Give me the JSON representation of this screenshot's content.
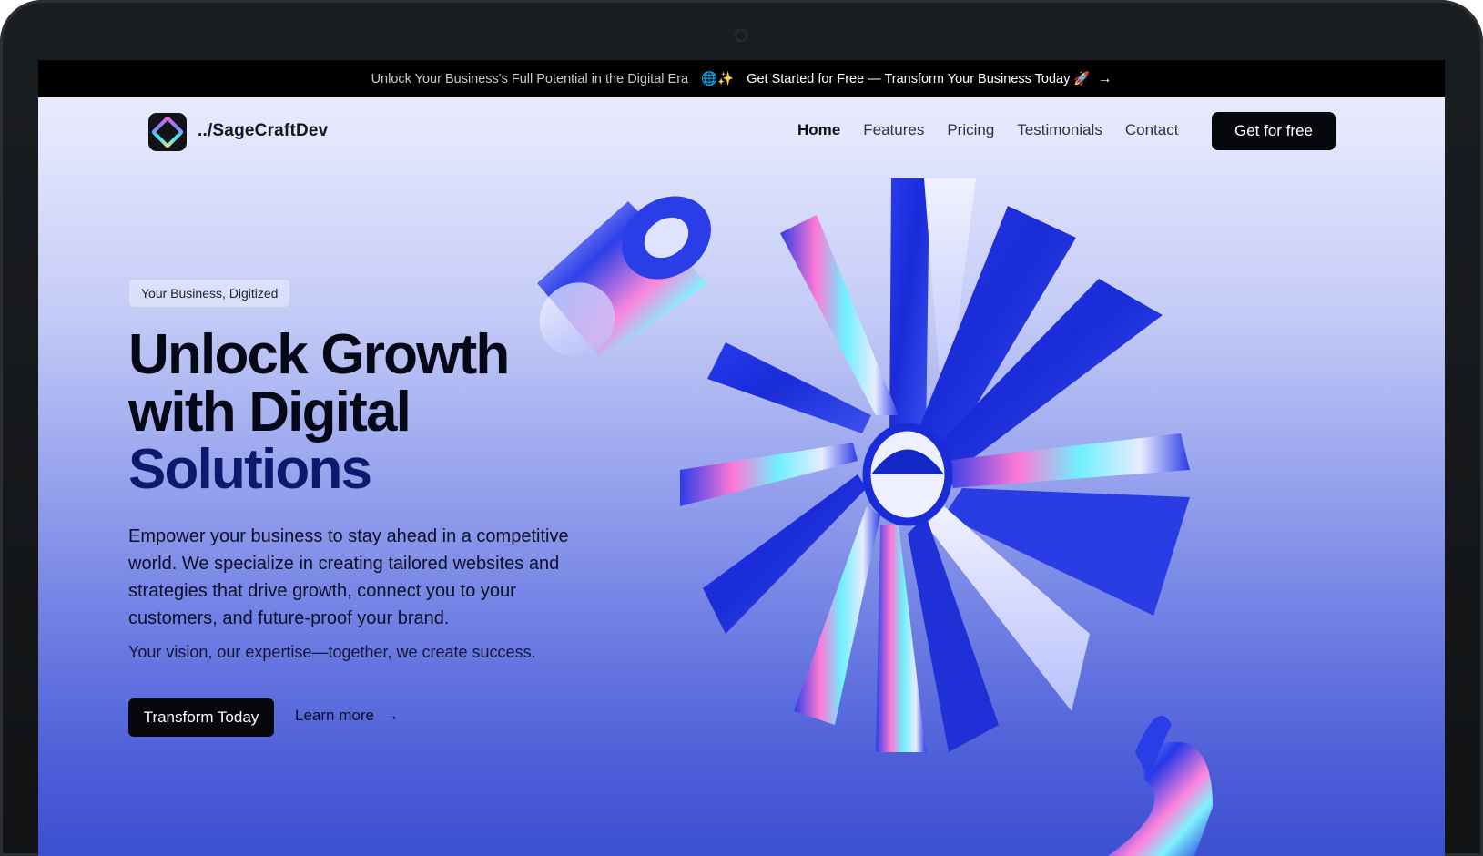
{
  "announcement": {
    "text": "Unlock Your Business's Full Potential in the Digital Era",
    "emoji": "🌐✨",
    "cta": "Get Started for Free — Transform Your Business Today 🚀",
    "arrow": "→"
  },
  "brand": {
    "name": "../SageCraftDev",
    "logo_icon": "diamond-gradient-icon"
  },
  "nav": {
    "links": [
      "Home",
      "Features",
      "Pricing",
      "Testimonials",
      "Contact"
    ],
    "active": "Home",
    "cta": "Get for free"
  },
  "hero": {
    "badge": "Your Business, Digitized",
    "headline": [
      "Unlock Growth",
      "with Digital",
      "Solutions"
    ],
    "description": "Empower your business to stay ahead in a competitive world. We specialize in creating tailored websites and strategies that drive growth, connect you to your customers, and future-proof your brand.",
    "tagline": "Your vision, our expertise—together, we create success.",
    "primary_cta": "Transform Today",
    "secondary_cta": "Learn more",
    "secondary_arrow": "→"
  },
  "colors": {
    "accent_dark": "#07080b",
    "headline_blue": "#0b1a6e",
    "art_blue": "#2336e0"
  }
}
